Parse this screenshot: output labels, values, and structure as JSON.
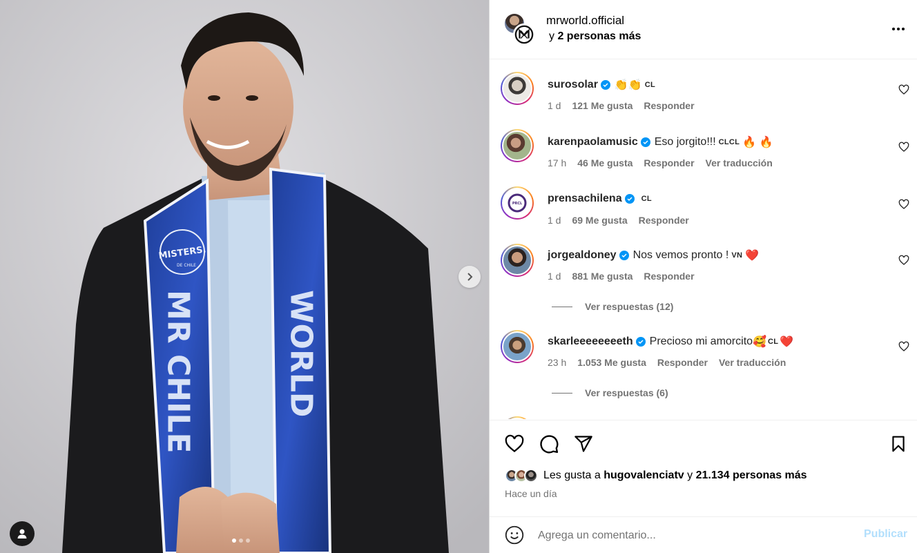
{
  "photo": {
    "sash_left_text": "MR CHILE",
    "sash_right_text": "WORLD",
    "sash_logo_text": "MISTERS.",
    "sash_logo_sub": "DE CHILE",
    "carousel_total": 3,
    "carousel_active": 1
  },
  "header": {
    "username": "mrworld.official",
    "collaborators_prefix": "y",
    "collaborators_bold": "2 personas más"
  },
  "comments": [
    {
      "user": "surosolar",
      "verified": true,
      "text": "",
      "emoji": "👏👏",
      "flag": "CL",
      "time": "1 d",
      "likes": "121 Me gusta",
      "reply": "Responder",
      "translate": ""
    },
    {
      "user": "karenpaolamusic",
      "verified": true,
      "text": "Eso jorgito!!!",
      "emoji": "🔥 🔥",
      "flag": "CLCL",
      "time": "17 h",
      "likes": "46 Me gusta",
      "reply": "Responder",
      "translate": "Ver traducción"
    },
    {
      "user": "prensachilena",
      "verified": true,
      "text": "",
      "emoji": "",
      "flag": "CL",
      "time": "1 d",
      "likes": "69 Me gusta",
      "reply": "Responder",
      "translate": ""
    },
    {
      "user": "jorgealdoney",
      "verified": true,
      "text": "Nos vemos pronto !",
      "emoji": "❤️",
      "flag": "VN",
      "time": "1 d",
      "likes": "881 Me gusta",
      "reply": "Responder",
      "translate": "",
      "view_replies": "Ver respuestas (12)"
    },
    {
      "user": "skarleeeeeeeeth",
      "verified": true,
      "text": "Precioso mi amorcito",
      "emoji_pre": "🥰",
      "emoji": "❤️",
      "flag": "CL",
      "time": "23 h",
      "likes": "1.053 Me gusta",
      "reply": "Responder",
      "translate": "Ver traducción",
      "view_replies": "Ver respuestas (6)"
    }
  ],
  "likes_summary": {
    "prefix": "Les gusta a",
    "user": "hugovalenciatv",
    "middle": "y",
    "rest": "21.134 personas más"
  },
  "posted": "Hace un día",
  "add_comment": {
    "placeholder": "Agrega un comentario...",
    "publish": "Publicar"
  },
  "icons": {
    "like": "heart-icon",
    "comment": "comment-bubble-icon",
    "share": "paper-plane-icon",
    "save": "bookmark-icon",
    "emoji": "smiley-icon",
    "more": "more-horizontal-icon",
    "next": "chevron-right-icon",
    "tag": "user-tag-icon"
  },
  "colors": {
    "accent": "#0095f6",
    "muted": "#737373",
    "publish_disabled": "#b2dffc",
    "heart_red": "#ff3040"
  }
}
